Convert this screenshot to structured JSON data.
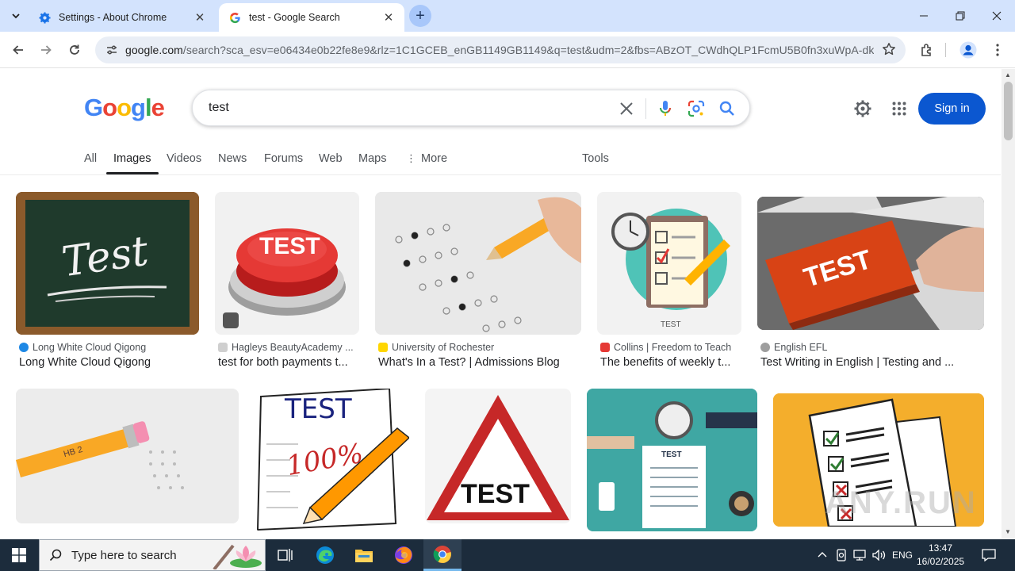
{
  "browser": {
    "tabs": [
      {
        "title": "Settings - About Chrome",
        "active": false
      },
      {
        "title": "test - Google Search",
        "active": true
      }
    ],
    "url_host": "google.com",
    "url_rest": "/search?sca_esv=e06434e0b22fe8e9&rlz=1C1GCEB_enGB1149GB1149&q=test&udm=2&fbs=ABzOT_CWdhQLP1FcmU5B0fn3xuWpA-dk4..."
  },
  "google": {
    "logo_letters": [
      "G",
      "o",
      "o",
      "g",
      "l",
      "e"
    ],
    "query": "test",
    "sign_in": "Sign in",
    "nav": [
      "All",
      "Images",
      "Videos",
      "News",
      "Forums",
      "Web",
      "Maps",
      "More",
      "Tools"
    ]
  },
  "results": [
    {
      "source": "Long White Cloud Qigong",
      "caption": "Long White Cloud Qigong",
      "thumb_text": "Test"
    },
    {
      "source": "Hagleys BeautyAcademy ...",
      "caption": "test for both payments t...",
      "thumb_text": "TEST"
    },
    {
      "source": "University of Rochester",
      "caption": "What's In a Test? | Admissions Blog",
      "thumb_text": ""
    },
    {
      "source": "Collins | Freedom to Teach",
      "caption": "The benefits of weekly t...",
      "thumb_text": "TEST"
    },
    {
      "source": "English EFL",
      "caption": "Test Writing in English | Testing and ...",
      "thumb_text": "TEST"
    },
    {
      "source": "",
      "caption": "",
      "thumb_text": "HB 2"
    },
    {
      "source": "",
      "caption": "",
      "thumb_text": "TEST"
    },
    {
      "source": "",
      "caption": "",
      "thumb_text": "TEST"
    },
    {
      "source": "",
      "caption": "",
      "thumb_text": "TEST"
    },
    {
      "source": "",
      "caption": "",
      "thumb_text": ""
    }
  ],
  "thumb_extra": {
    "percent": "100%",
    "sheet_small": "TEST"
  },
  "watermark": "ANY.RUN",
  "taskbar": {
    "search_placeholder": "Type here to search",
    "lang": "ENG",
    "time": "13:47",
    "date": "16/02/2025"
  },
  "colors": {
    "accent": "#0b57d0",
    "tabstrip": "#d3e3fd",
    "taskbar": "#1c2c3c"
  }
}
